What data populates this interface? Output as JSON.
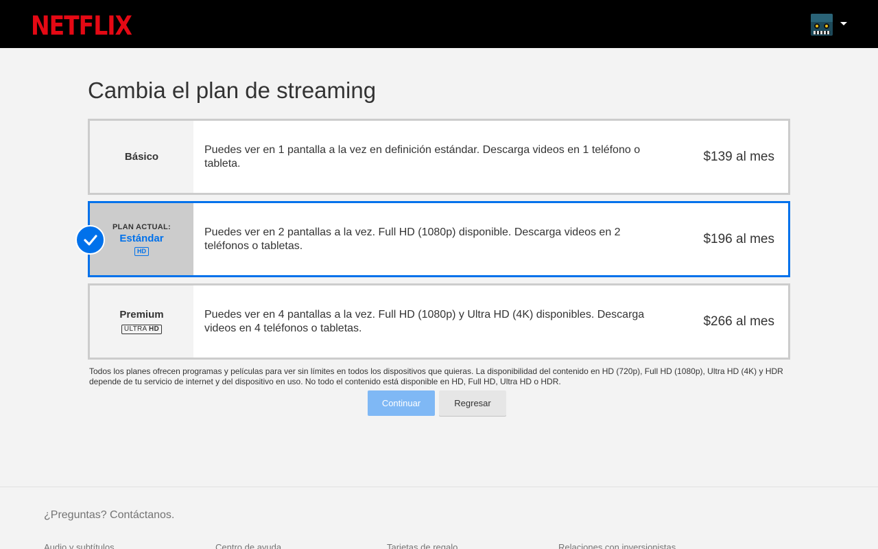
{
  "header": {
    "logo": "NETFLIX"
  },
  "page": {
    "title": "Cambia el plan de streaming"
  },
  "plans": [
    {
      "name": "Básico",
      "description": "Puedes ver en 1 pantalla a la vez en definición estándar. Descarga videos en 1 teléfono o tableta.",
      "price": "$139 al mes"
    },
    {
      "current_label": "PLAN ACTUAL:",
      "name": "Estándar",
      "badge": "HD",
      "description": "Puedes ver en 2 pantallas a la vez. Full HD (1080p) disponible. Descarga videos en 2 teléfonos o tabletas.",
      "price": "$196 al mes",
      "selected": true
    },
    {
      "name": "Premium",
      "badge_prefix": "ULTRA",
      "badge_suffix": "HD",
      "description": "Puedes ver en 4 pantallas a la vez. Full HD (1080p) y Ultra HD (4K) disponibles. Descarga videos en 4 teléfonos o tabletas.",
      "price": "$266 al mes"
    }
  ],
  "disclaimer": "Todos los planes ofrecen programas y películas para ver sin límites en todos los dispositivos que quieras. La disponibilidad del contenido en HD (720p), Full HD (1080p), Ultra HD (4K) y HDR depende de tu servicio de internet y del dispositivo en uso. No todo el contenido está disponible en HD, Full HD, Ultra HD o HDR.",
  "buttons": {
    "continue": "Continuar",
    "back": "Regresar"
  },
  "footer": {
    "question": "¿Preguntas? Contáctanos.",
    "links": [
      "Audio y subtítulos",
      "Centro de ayuda",
      "Tarjetas de regalo",
      "Relaciones con inversionistas"
    ]
  },
  "colors": {
    "brand": "#e50914",
    "accent": "#0071eb"
  },
  "icons": {
    "avatar": "profile-avatar-icon",
    "dropdown": "caret-down-icon",
    "selected": "check-icon"
  }
}
